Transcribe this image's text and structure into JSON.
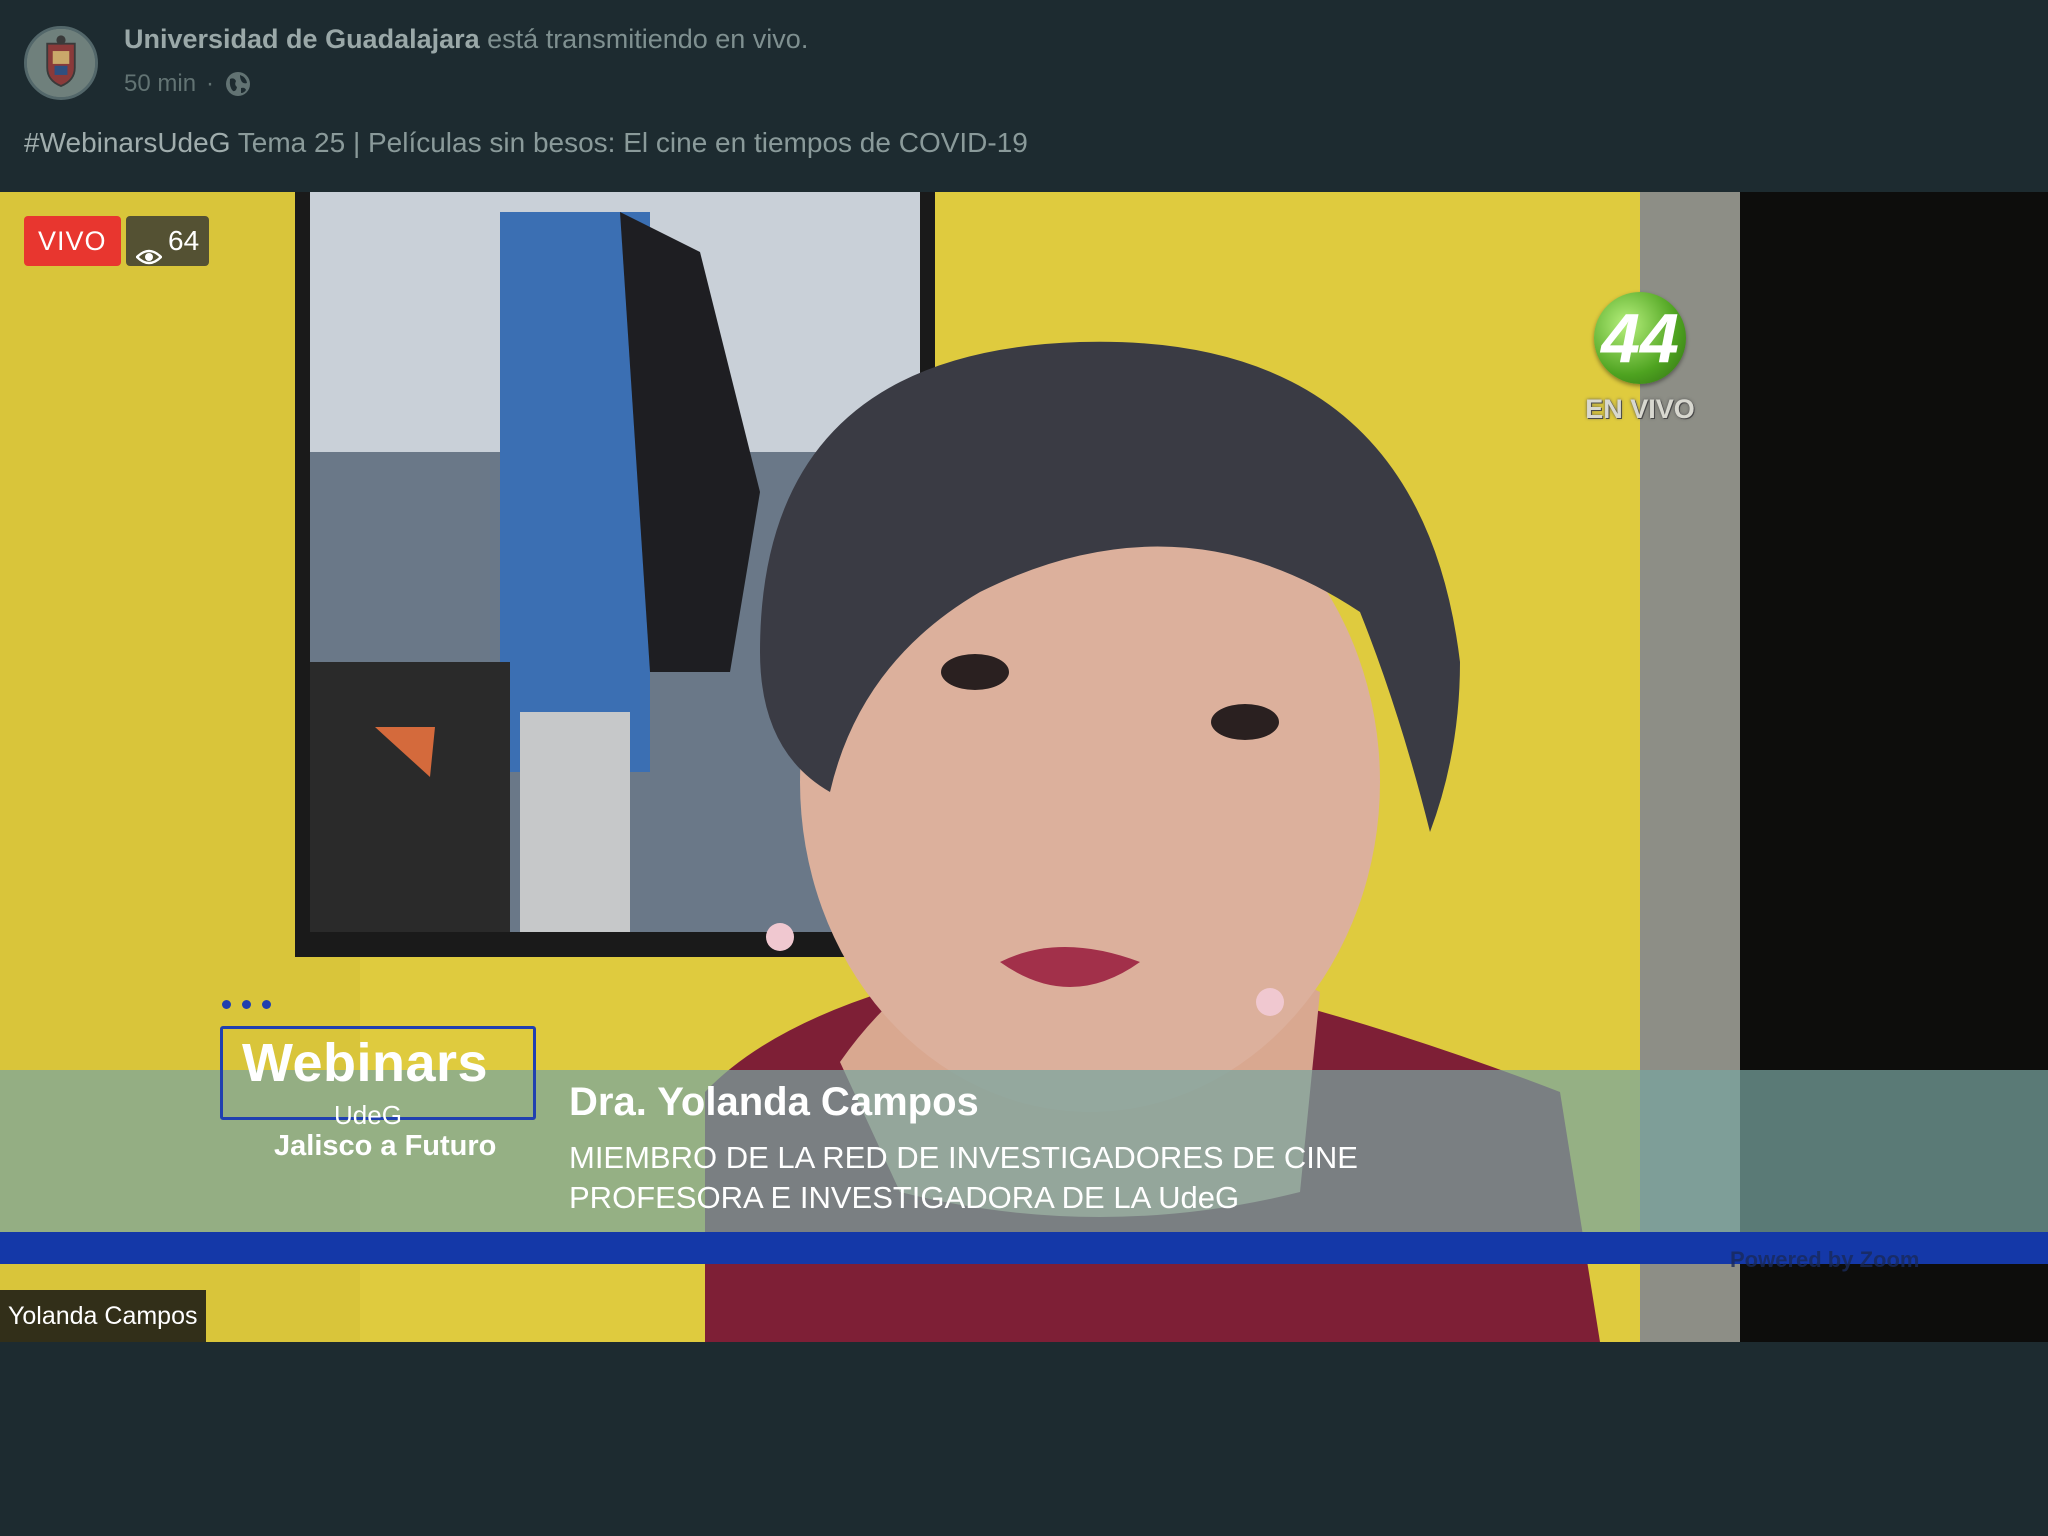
{
  "post": {
    "page_name": "Universidad de Guadalajara",
    "action_text": "está transmitiendo en vivo.",
    "time": "50 min",
    "separator": "·",
    "hashtag": "#WebinarsUdeG",
    "title": "Tema 25 | Películas sin besos: El cine en tiempos de COVID-19"
  },
  "video": {
    "live_label": "VIVO",
    "viewers": "64",
    "channel_number": "44",
    "channel_live": "EN VIVO",
    "webinars_title": "Webinars",
    "webinars_sub": "UdeG",
    "webinars_tag": "Jalisco a Futuro",
    "speaker_name": "Dra. Yolanda Campos",
    "speaker_line1": "MIEMBRO DE LA RED DE INVESTIGADORES DE CINE",
    "speaker_line2": "PROFESORA E INVESTIGADORA DE LA UdeG",
    "powered_by": "Powered by Zoom",
    "participant_name": "Yolanda Campos"
  },
  "colors": {
    "background": "#1d2b30",
    "live_red": "#e8362f",
    "banner_blue": "#1438a8",
    "wall_yellow": "#e0cc3a"
  },
  "icons": [
    "globe-icon",
    "eye-icon"
  ]
}
